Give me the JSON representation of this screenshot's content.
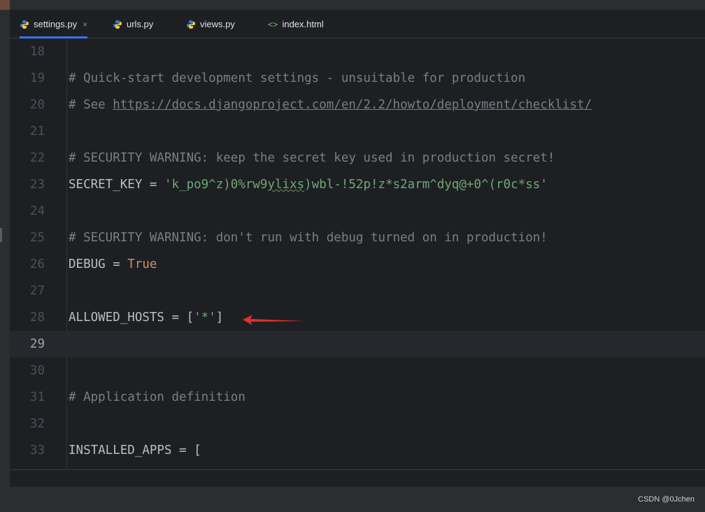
{
  "tabs": [
    {
      "label": "settings.py",
      "icon": "python-icon",
      "active": true,
      "close": "×"
    },
    {
      "label": "urls.py",
      "icon": "python-icon",
      "active": false
    },
    {
      "label": "views.py",
      "icon": "python-icon",
      "active": false
    },
    {
      "label": "index.html",
      "icon": "html-icon",
      "active": false,
      "icon_glyph": "<>"
    }
  ],
  "editor": {
    "current_line": "29",
    "lines": [
      {
        "num": "18"
      },
      {
        "num": "19",
        "comment": "# Quick-start development settings - unsuitable for production"
      },
      {
        "num": "20",
        "prefix": "# See ",
        "url": "https://docs.djangoproject.com/en/2.2/howto/deployment/checklist/"
      },
      {
        "num": "21"
      },
      {
        "num": "22",
        "comment": "# SECURITY WARNING: keep the secret key used in production secret!"
      },
      {
        "num": "23",
        "name": "SECRET_KEY",
        "op": " = ",
        "str_a": "'k_po9^z)0%rw9",
        "str_typo": "ylixs",
        "str_b": ")wbl-!52p!z*s2arm^dyq@+0^(r0c*ss'"
      },
      {
        "num": "24"
      },
      {
        "num": "25",
        "comment": "# SECURITY WARNING: don't run with debug turned on in production!"
      },
      {
        "num": "26",
        "name": "DEBUG",
        "op": " = ",
        "kw": "True"
      },
      {
        "num": "27"
      },
      {
        "num": "28",
        "name": "ALLOWED_HOSTS",
        "op": " = [",
        "str": "'*'",
        "close": "]"
      },
      {
        "num": "29"
      },
      {
        "num": "30"
      },
      {
        "num": "31",
        "comment": "# Application definition"
      },
      {
        "num": "32"
      },
      {
        "num": "33",
        "name": "INSTALLED_APPS",
        "op": " = ["
      }
    ]
  },
  "annotation": {
    "arrow_color": "#e0312b"
  },
  "watermark": "CSDN @0Jchen",
  "colors": {
    "background": "#1e1f22",
    "comment": "#7a7e85",
    "string": "#6aab73",
    "keyword": "#cf8e6d",
    "text": "#bcbec4",
    "tab_accent": "#3574f0"
  }
}
